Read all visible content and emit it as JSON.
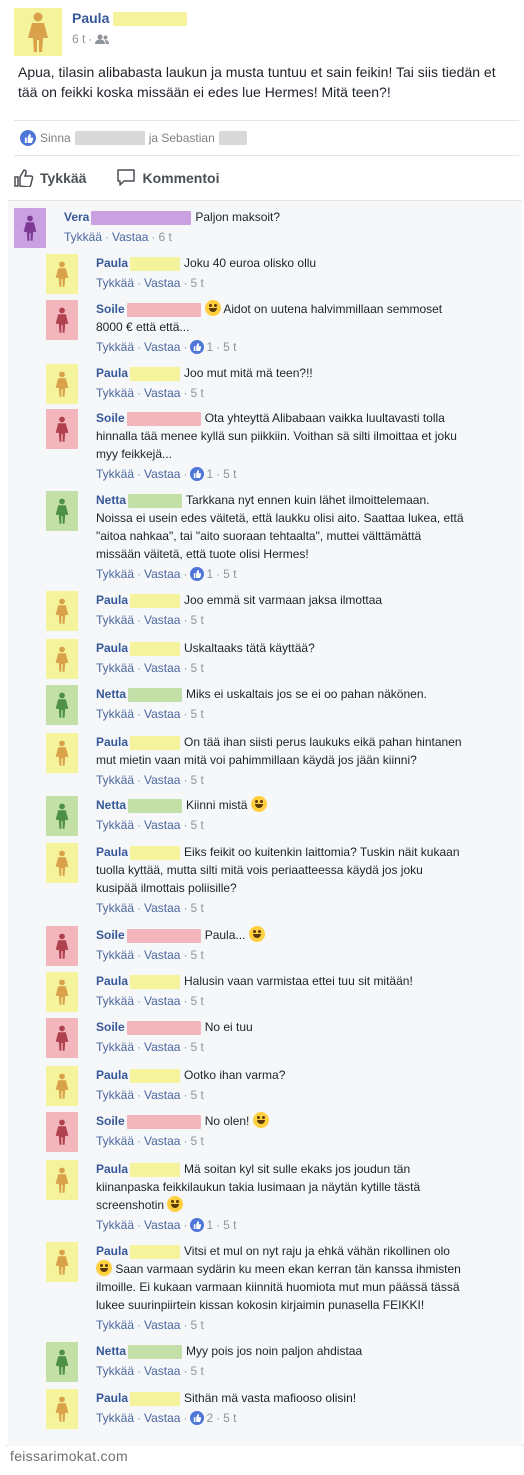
{
  "post": {
    "author": "Paula",
    "time": "6 t",
    "text": "Apua, tilasin alibabasta laukun ja musta tuntuu et sain feikin! Tai siis tiedän et tää on feikki koska missään ei edes lue Hermes! Mitä teen?!",
    "likes_prefix": "Sinna",
    "likes_middle": "ja Sebastian",
    "actions": {
      "like": "Tykkää",
      "comment": "Kommentoi"
    }
  },
  "colors": {
    "Paula": "#f5f39c",
    "Vera": "#c9a0e0",
    "Soile": "#f4b6bd",
    "Netta": "#c2e0a8",
    "link": "#365899"
  },
  "comment_labels": {
    "like": "Tykkää",
    "reply": "Vastaa"
  },
  "comments": [
    {
      "name": "Vera",
      "text": "Paljon maksoit?",
      "time": "6 t"
    },
    {
      "name": "Paula",
      "text": "Joku 40 euroa olisko ollu",
      "time": "5 t"
    },
    {
      "name": "Soile",
      "text": "Aidot on uutena halvimmillaan semmoset 8000 € että että...",
      "time": "5 t",
      "reactions": "1"
    },
    {
      "name": "Paula",
      "text": "Joo mut mitä mä teen?!!",
      "time": "5 t"
    },
    {
      "name": "Soile",
      "text": "Ota yhteyttä Alibabaan vaikka luultavasti tolla hinnalla tää menee kyllä sun piikkiin. Voithan sä silti ilmoittaa et joku myy feikkejä...",
      "time": "5 t",
      "reactions": "1"
    },
    {
      "name": "Netta",
      "text": "Tarkkana nyt ennen kuin lähet ilmoittelemaan. Noissa ei usein edes väitetä, että laukku olisi aito. Saattaa lukea, että \"aitoa nahkaa\", tai \"aito suoraan tehtaalta\", muttei välttämättä missään väitetä, että tuote olisi Hermes!",
      "time": "5 t",
      "reactions": "1"
    },
    {
      "name": "Paula",
      "text": "Joo emmä sit varmaan jaksa ilmottaa",
      "time": "5 t"
    },
    {
      "name": "Paula",
      "text": "Uskaltaaks tätä käyttää?",
      "time": "5 t"
    },
    {
      "name": "Netta",
      "text": "Miks ei uskaltais jos se ei oo pahan näkönen.",
      "time": "5 t"
    },
    {
      "name": "Paula",
      "text": "On tää ihan siisti perus laukuks eikä pahan hintanen mut mietin vaan mitä voi pahimmillaan käydä jos jään kiinni?",
      "time": "5 t"
    },
    {
      "name": "Netta",
      "text": "Kiinni mistä",
      "time": "5 t"
    },
    {
      "name": "Paula",
      "text": "Eiks feikit oo kuitenkin laittomia? Tuskin näit kukaan tuolla kyttää, mutta silti mitä vois periaatteessa käydä jos joku kusipää ilmottais poliisille?",
      "time": "5 t"
    },
    {
      "name": "Soile",
      "text": "Paula...",
      "time": "5 t"
    },
    {
      "name": "Paula",
      "text": "Halusin vaan varmistaa ettei tuu sit mitään!",
      "time": "5 t"
    },
    {
      "name": "Soile",
      "text": "No ei tuu",
      "time": "5 t"
    },
    {
      "name": "Paula",
      "text": "Ootko ihan varma?",
      "time": "5 t"
    },
    {
      "name": "Soile",
      "text": "No olen!",
      "time": "5 t"
    },
    {
      "name": "Paula",
      "text": "Mä soitan kyl sit sulle ekaks jos joudun tän kiinanpaska feikkilaukun takia lusimaan ja näytän kytille tästä screenshotin",
      "time": "5 t",
      "reactions": "1"
    },
    {
      "name": "Paula",
      "text": "Vitsi et mul on nyt raju ja ehkä vähän rikollinen olo",
      "text2": "Saan varmaan sydärin ku meen ekan kerran tän kanssa ihmisten ilmoille. Ei kukaan varmaan kiinnitä huomiota mut mun päässä tässä lukee suurinpiirtein kissan kokosin kirjaimin punasella FEIKKI!",
      "time": "5 t"
    },
    {
      "name": "Netta",
      "text": "Myy pois jos noin paljon ahdistaa",
      "time": "5 t"
    },
    {
      "name": "Paula",
      "text": "Sithän mä vasta mafiooso olisin!",
      "time": "5 t",
      "reactions": "2"
    }
  ],
  "watermark": "feissarimokat.com"
}
